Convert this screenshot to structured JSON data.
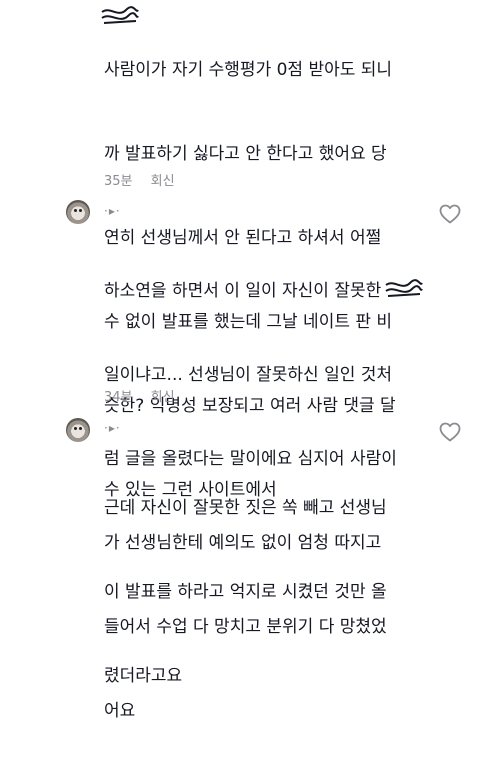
{
  "comments": [
    {
      "text": "",
      "lines": [
        "사람이가 자기 수행평가 0점 받아도 되니",
        "까 발표하기 싫다고 안 한다고 했어요 당",
        "연히 선생님께서 안 된다고 하셔서 어쩔",
        "수 없이 발표를 했는데 그날 네이트 판 비",
        "슷한? 익명성 보장되고 여러 사람 댓글 달",
        "수 있는 그런 사이트에서"
      ],
      "time": "35분",
      "reply_label": "회신"
    },
    {
      "username": "·▸·",
      "lines": [
        "하소연을 하면서 이 일이 자신이 잘못한",
        "일이냐고... 선생님이 잘못하신 일인 것처",
        "럼 글을 올렸다는 말이에요 심지어 사람이",
        "가 선생님한테 예의도 없이 엄청 따지고",
        "들어서 수업 다 망치고 분위기 다 망쳤었",
        "어요"
      ],
      "time": "34분",
      "reply_label": "회신"
    },
    {
      "username": "·▸·",
      "lines": [
        "근데 자신이 잘못한 짓은 쏙 빼고 선생님",
        "이 발표를 하라고 억지로 시켰던 것만 올",
        "렸더라고요"
      ]
    }
  ],
  "icons": {
    "like": "heart-outline-icon",
    "avatar": "cat-avatar"
  },
  "colors": {
    "text": "#161823",
    "secondary": "#8a8b91",
    "background": "#ffffff"
  }
}
